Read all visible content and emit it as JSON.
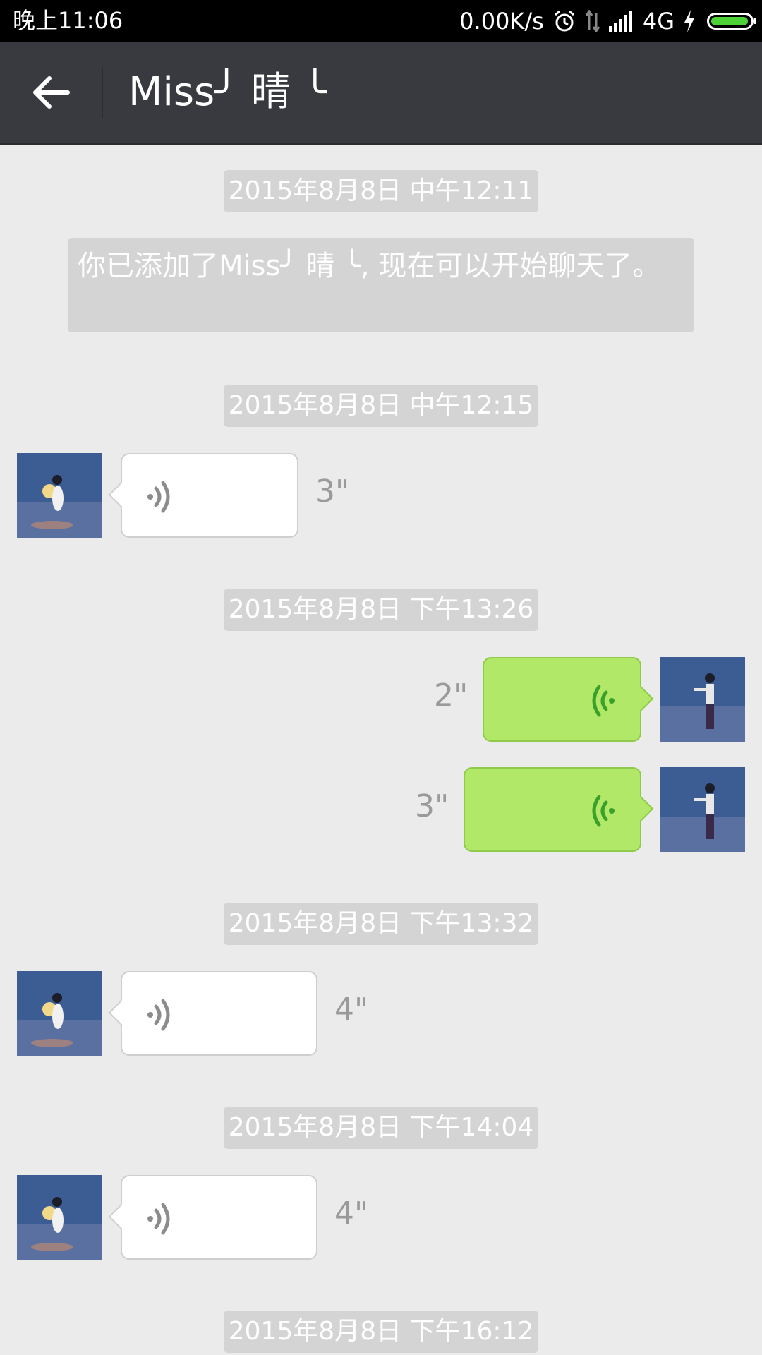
{
  "status_bar": {
    "time": "晚上11:06",
    "speed": "0.00K/s",
    "network": "4G",
    "icons": [
      "alarm-icon",
      "data-arrows-icon",
      "signal-icon",
      "charging-icon",
      "battery-icon"
    ]
  },
  "header": {
    "title": "Miss╯ 晴 ╰",
    "back_icon": "back-arrow-icon"
  },
  "messages": [
    {
      "type": "timestamp",
      "text": "2015年8月8日 中午12:11"
    },
    {
      "type": "system",
      "text": "你已添加了Miss╯ 晴 ╰, 现在可以开始聊天了。"
    },
    {
      "type": "timestamp",
      "text": "2015年8月8日 中午12:15"
    },
    {
      "type": "voice",
      "direction": "incoming",
      "duration": "3\""
    },
    {
      "type": "timestamp",
      "text": "2015年8月8日 下午13:26"
    },
    {
      "type": "voice",
      "direction": "outgoing",
      "duration": "2\""
    },
    {
      "type": "voice",
      "direction": "outgoing",
      "duration": "3\""
    },
    {
      "type": "timestamp",
      "text": "2015年8月8日 下午13:32"
    },
    {
      "type": "voice",
      "direction": "incoming",
      "duration": "4\""
    },
    {
      "type": "timestamp",
      "text": "2015年8月8日 下午14:04"
    },
    {
      "type": "voice",
      "direction": "incoming",
      "duration": "4\""
    },
    {
      "type": "timestamp",
      "text": "2015年8月8日 下午16:12"
    }
  ],
  "colors": {
    "background": "#ebebeb",
    "title_bar": "#393a3f",
    "outgoing_bubble": "#b2e867",
    "incoming_bubble": "#ffffff",
    "timestamp_bg": "#d4d4d4",
    "voice_icon_out": "#3aa02a",
    "voice_icon_in": "#8c8c8c"
  }
}
